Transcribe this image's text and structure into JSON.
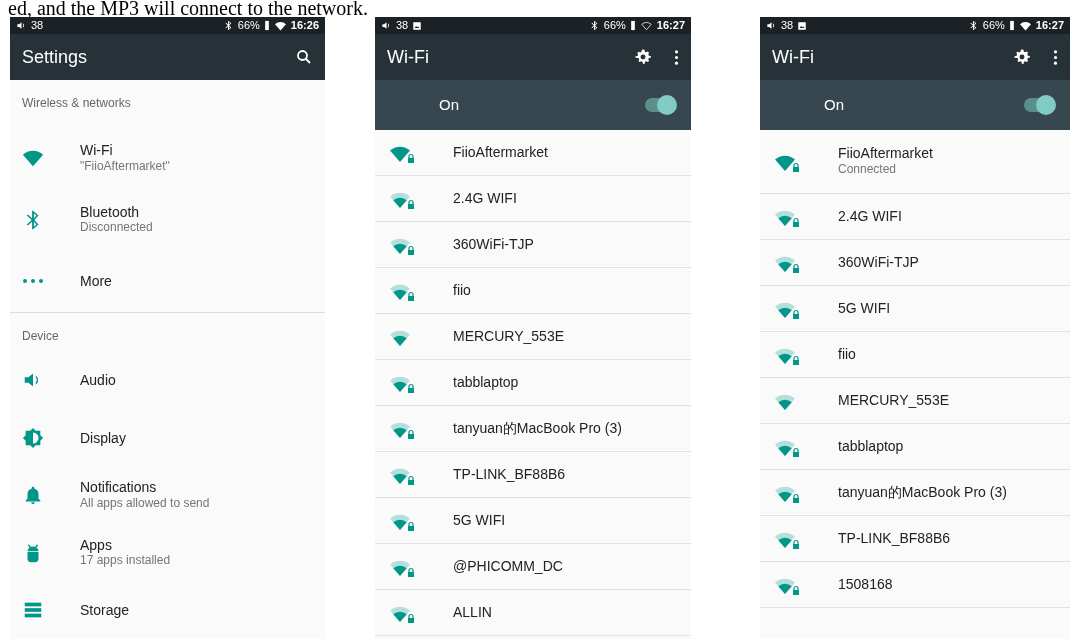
{
  "caption": "ed, and the MP3 will connect to the network.",
  "screens": [
    {
      "kind": "settings",
      "status_bar": {
        "volume": "38",
        "image_notification": false,
        "battery": "66%",
        "wifi_connected": true,
        "time": "16:26"
      },
      "title": "Settings",
      "sections": [
        {
          "header": "Wireless & networks",
          "items": [
            {
              "kind": "wifi",
              "title": "Wi-Fi",
              "subtitle": "\"FiioAftermarket\""
            },
            {
              "kind": "bluetooth",
              "title": "Bluetooth",
              "subtitle": "Disconnected"
            },
            {
              "kind": "more",
              "title": "More"
            }
          ]
        },
        {
          "header": "Device",
          "items": [
            {
              "kind": "audio",
              "title": "Audio"
            },
            {
              "kind": "display",
              "title": "Display"
            },
            {
              "kind": "notifications",
              "title": "Notifications",
              "subtitle": "All apps allowed to send"
            },
            {
              "kind": "apps",
              "title": "Apps",
              "subtitle": "17 apps installed"
            },
            {
              "kind": "storage",
              "title": "Storage"
            }
          ]
        }
      ]
    },
    {
      "kind": "wifi",
      "status_bar": {
        "volume": "38",
        "image_notification": true,
        "battery": "66%",
        "wifi_connected": false,
        "time": "16:27"
      },
      "title": "Wi-Fi",
      "toggle": {
        "label": "On",
        "on": true
      },
      "networks": [
        {
          "name": "FiioAftermarket",
          "strong": true,
          "secured": true
        },
        {
          "name": "2.4G WIFI",
          "strong": false,
          "secured": true
        },
        {
          "name": "360WiFi-TJP",
          "strong": false,
          "secured": true
        },
        {
          "name": "fiio",
          "strong": false,
          "secured": true
        },
        {
          "name": "MERCURY_553E",
          "strong": false,
          "secured": false
        },
        {
          "name": "tabblaptop",
          "strong": false,
          "secured": true
        },
        {
          "name": "tanyuan的MacBook Pro (3)",
          "strong": false,
          "secured": true
        },
        {
          "name": "TP-LINK_BF88B6",
          "strong": false,
          "secured": true
        },
        {
          "name": "5G WIFI",
          "strong": false,
          "secured": true
        },
        {
          "name": "@PHICOMM_DC",
          "strong": false,
          "secured": true
        },
        {
          "name": "ALLIN",
          "strong": false,
          "secured": true
        }
      ]
    },
    {
      "kind": "wifi",
      "status_bar": {
        "volume": "38",
        "image_notification": true,
        "battery": "66%",
        "wifi_connected": true,
        "time": "16:27"
      },
      "title": "Wi-Fi",
      "toggle": {
        "label": "On",
        "on": true
      },
      "networks": [
        {
          "name": "FiioAftermarket",
          "status": "Connected",
          "strong": true,
          "secured": true
        },
        {
          "name": "2.4G WIFI",
          "strong": false,
          "secured": true
        },
        {
          "name": "360WiFi-TJP",
          "strong": false,
          "secured": true
        },
        {
          "name": "5G WIFI",
          "strong": false,
          "secured": true
        },
        {
          "name": "fiio",
          "strong": false,
          "secured": true
        },
        {
          "name": "MERCURY_553E",
          "strong": false,
          "secured": false
        },
        {
          "name": "tabblaptop",
          "strong": false,
          "secured": true
        },
        {
          "name": "tanyuan的MacBook Pro (3)",
          "strong": false,
          "secured": true
        },
        {
          "name": "TP-LINK_BF88B6",
          "strong": false,
          "secured": true
        },
        {
          "name": "1508168",
          "strong": false,
          "secured": true
        }
      ]
    }
  ]
}
